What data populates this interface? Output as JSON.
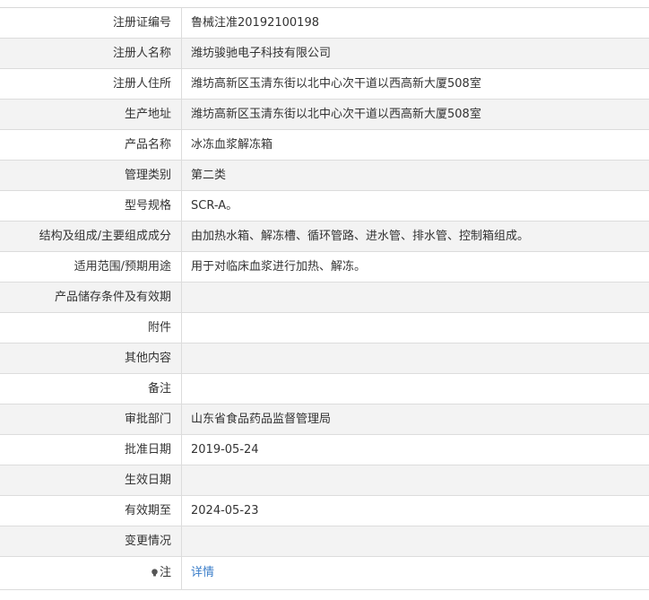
{
  "rows": [
    {
      "label": "注册证编号",
      "value": "鲁械注准20192100198"
    },
    {
      "label": "注册人名称",
      "value": "潍坊骏驰电子科技有限公司"
    },
    {
      "label": "注册人住所",
      "value": "潍坊高新区玉清东街以北中心次干道以西高新大厦508室"
    },
    {
      "label": "生产地址",
      "value": "潍坊高新区玉清东街以北中心次干道以西高新大厦508室"
    },
    {
      "label": "产品名称",
      "value": "冰冻血浆解冻箱"
    },
    {
      "label": "管理类别",
      "value": "第二类"
    },
    {
      "label": "型号规格",
      "value": "SCR-A。"
    },
    {
      "label": "结构及组成/主要组成成分",
      "value": "由加热水箱、解冻槽、循环管路、进水管、排水管、控制箱组成。"
    },
    {
      "label": "适用范围/预期用途",
      "value": "用于对临床血浆进行加热、解冻。"
    },
    {
      "label": "产品储存条件及有效期",
      "value": ""
    },
    {
      "label": "附件",
      "value": ""
    },
    {
      "label": "其他内容",
      "value": ""
    },
    {
      "label": "备注",
      "value": ""
    },
    {
      "label": "审批部门",
      "value": "山东省食品药品监督管理局"
    },
    {
      "label": "批准日期",
      "value": "2019-05-24"
    },
    {
      "label": "生效日期",
      "value": ""
    },
    {
      "label": "有效期至",
      "value": "2024-05-23"
    },
    {
      "label": "变更情况",
      "value": ""
    }
  ],
  "note_row": {
    "label": "注",
    "link_text": "详情",
    "icon": "info-bulb-icon"
  },
  "colors": {
    "row_alt_bg": "#f3f3f3",
    "border": "#dcdcdc",
    "text": "#333333",
    "link": "#3a7dc9"
  }
}
